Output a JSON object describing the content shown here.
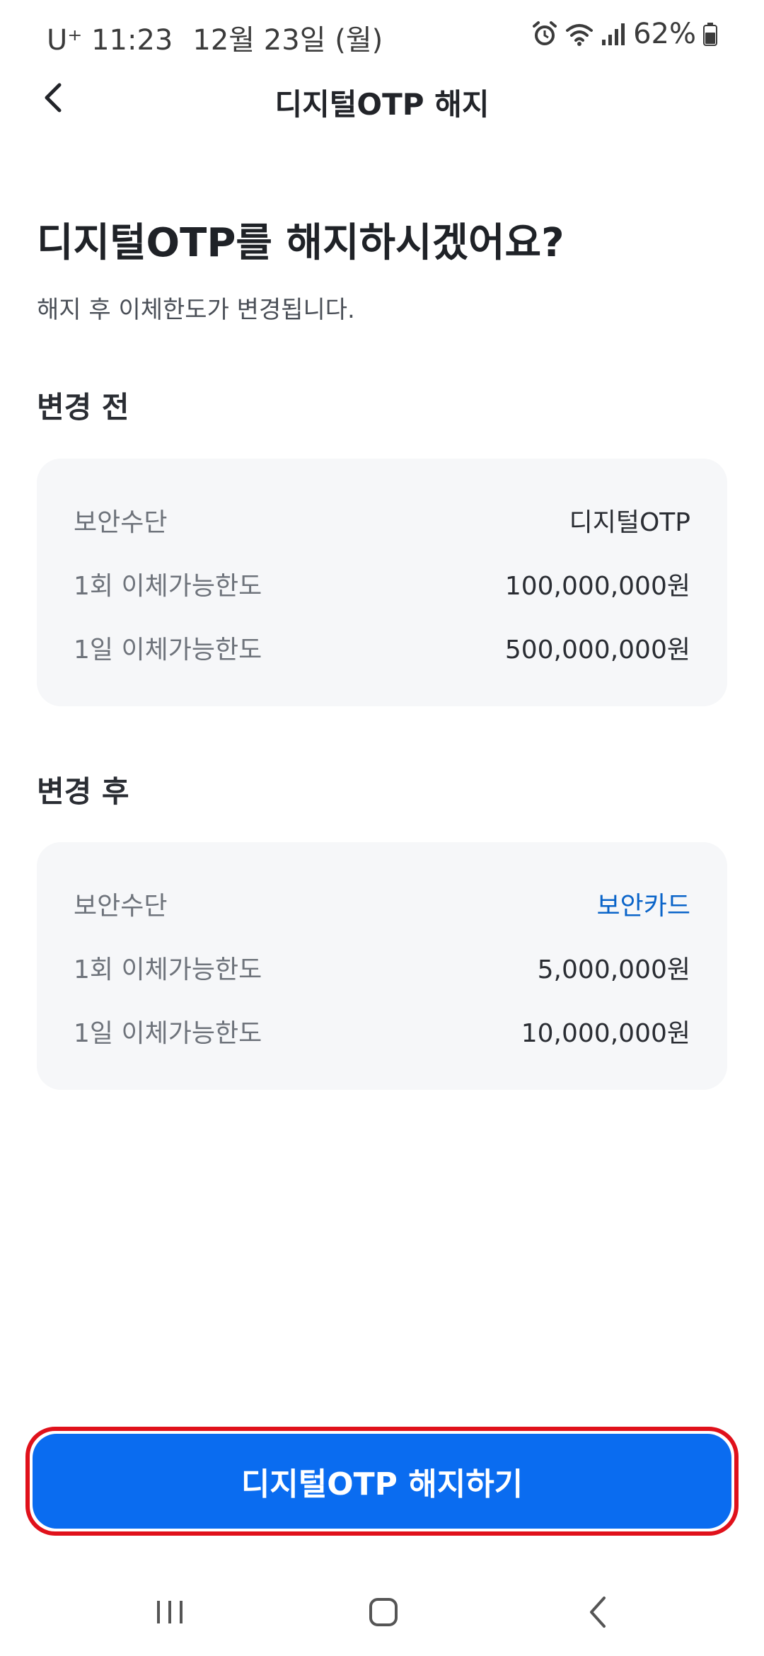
{
  "status_bar": {
    "carrier": "U⁺",
    "time": "11:23",
    "date": "12월 23일 (월)",
    "battery": "62%"
  },
  "header": {
    "title": "디지털OTP 해지"
  },
  "main": {
    "headline": "디지털OTP를 해지하시겠어요?",
    "subtext": "해지 후 이체한도가 변경됩니다."
  },
  "before": {
    "title": "변경 전",
    "rows": [
      {
        "label": "보안수단",
        "value": "디지털OTP"
      },
      {
        "label": "1회 이체가능한도",
        "value": "100,000,000원"
      },
      {
        "label": "1일 이체가능한도",
        "value": "500,000,000원"
      }
    ]
  },
  "after": {
    "title": "변경 후",
    "rows": [
      {
        "label": "보안수단",
        "value": "보안카드"
      },
      {
        "label": "1회 이체가능한도",
        "value": "5,000,000원"
      },
      {
        "label": "1일 이체가능한도",
        "value": "10,000,000원"
      }
    ]
  },
  "cta": {
    "label": "디지털OTP 해지하기"
  },
  "colors": {
    "primary": "#0a6cf0",
    "accent_text": "#0a64c9",
    "highlight_border": "#e0111b",
    "card_background": "#f6f7f9"
  },
  "icons": {
    "back": "chevron-left-icon",
    "alarm": "alarm-icon",
    "wifi": "wifi-icon",
    "signal": "signal-icon",
    "battery": "battery-icon",
    "nav_recents": "recents-icon",
    "nav_home": "home-icon",
    "nav_back": "back-icon"
  }
}
